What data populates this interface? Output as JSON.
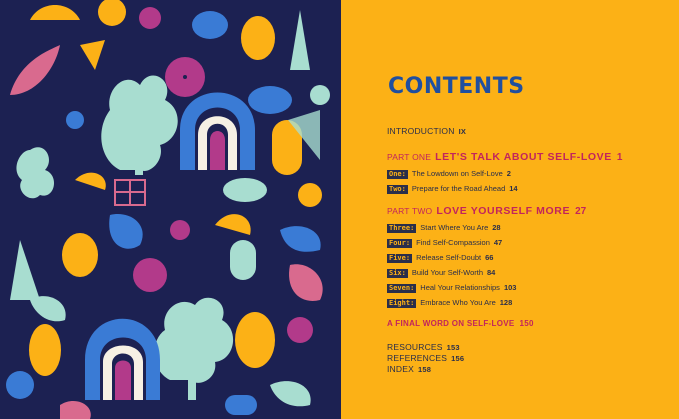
{
  "contents": {
    "title": "CONTENTS",
    "introduction": {
      "label": "INTRODUCTION",
      "page": "IX"
    },
    "parts": [
      {
        "label": "PART ONE",
        "title": "LET'S TALK ABOUT SELF-LOVE",
        "page": "1",
        "chapters": [
          {
            "number": "One:",
            "title": "The Lowdown on Self-Love",
            "page": "2"
          },
          {
            "number": "Two:",
            "title": "Prepare for the Road Ahead",
            "page": "14"
          }
        ]
      },
      {
        "label": "PART TWO",
        "title": "LOVE YOURSELF MORE",
        "page": "27",
        "chapters": [
          {
            "number": "Three:",
            "title": "Start Where You Are",
            "page": "28"
          },
          {
            "number": "Four:",
            "title": "Find Self-Compassion",
            "page": "47"
          },
          {
            "number": "Five:",
            "title": "Release Self-Doubt",
            "page": "66"
          },
          {
            "number": "Six:",
            "title": "Build Your Self-Worth",
            "page": "84"
          },
          {
            "number": "Seven:",
            "title": "Heal Your Relationships",
            "page": "103"
          },
          {
            "number": "Eight:",
            "title": "Embrace Who You Are",
            "page": "128"
          }
        ]
      }
    ],
    "final_word": {
      "title": "A FINAL WORD ON SELF-LOVE",
      "page": "150"
    },
    "back_matter": [
      {
        "title": "RESOURCES",
        "page": "153"
      },
      {
        "title": "REFERENCES",
        "page": "156"
      },
      {
        "title": "INDEX",
        "page": "158"
      }
    ]
  },
  "colors": {
    "page_background": "#fcb116",
    "art_background": "#1c2152",
    "title": "#1f4fa0",
    "part_headings": "#c2255c",
    "body_text": "#2a2e4a"
  }
}
